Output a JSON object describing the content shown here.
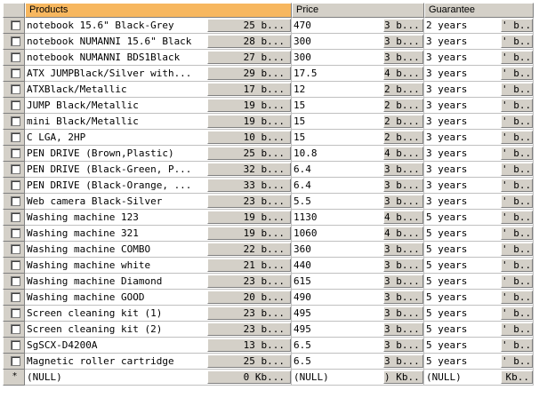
{
  "columns": {
    "products": "Products",
    "price": "Price",
    "guarantee": "Guarantee"
  },
  "rows": [
    {
      "product": "notebook 15.6\" Black-Grey",
      "pbtn": "25 b...",
      "price": "470",
      "prbtn": "3 b...",
      "guarantee": "2 years",
      "gbtn": "' b.."
    },
    {
      "product": "notebook NUMANNI 15.6\" Black",
      "pbtn": "28 b...",
      "price": "300",
      "prbtn": "3 b...",
      "guarantee": "3 years",
      "gbtn": "' b.."
    },
    {
      "product": "notebook NUMANNI BDS1Black",
      "pbtn": "27 b...",
      "price": "300",
      "prbtn": "3 b...",
      "guarantee": "3 years",
      "gbtn": "' b.."
    },
    {
      "product": "ATX JUMPBlack/Silver with...",
      "pbtn": "29 b...",
      "price": "17.5",
      "prbtn": "4 b...",
      "guarantee": "3 years",
      "gbtn": "' b.."
    },
    {
      "product": "ATXBlack/Metallic",
      "pbtn": "17 b...",
      "price": "12",
      "prbtn": "2 b...",
      "guarantee": "3 years",
      "gbtn": "' b.."
    },
    {
      "product": "JUMP Black/Metallic",
      "pbtn": "19 b...",
      "price": "15",
      "prbtn": "2 b...",
      "guarantee": "3 years",
      "gbtn": "' b.."
    },
    {
      "product": "mini Black/Metallic",
      "pbtn": "19 b...",
      "price": "15",
      "prbtn": "2 b...",
      "guarantee": "3 years",
      "gbtn": "' b.."
    },
    {
      "product": "C LGA, 2HP",
      "pbtn": "10 b...",
      "price": "15",
      "prbtn": "2 b...",
      "guarantee": "3 years",
      "gbtn": "' b.."
    },
    {
      "product": "PEN DRIVE (Brown,Plastic)",
      "pbtn": "25 b...",
      "price": "10.8",
      "prbtn": "4 b...",
      "guarantee": "3 years",
      "gbtn": "' b.."
    },
    {
      "product": "PEN DRIVE (Black-Green, P...",
      "pbtn": "32 b...",
      "price": "6.4",
      "prbtn": "3 b...",
      "guarantee": "3 years",
      "gbtn": "' b.."
    },
    {
      "product": "PEN DRIVE (Black-Orange, ...",
      "pbtn": "33 b...",
      "price": "6.4",
      "prbtn": "3 b...",
      "guarantee": "3 years",
      "gbtn": "' b.."
    },
    {
      "product": "Web camera Black-Silver",
      "pbtn": "23 b...",
      "price": "5.5",
      "prbtn": "3 b...",
      "guarantee": "3 years",
      "gbtn": "' b.."
    },
    {
      "product": "Washing machine 123",
      "pbtn": "19 b...",
      "price": "1130",
      "prbtn": "4 b...",
      "guarantee": "5 years",
      "gbtn": "' b.."
    },
    {
      "product": "Washing machine 321",
      "pbtn": "19 b...",
      "price": "1060",
      "prbtn": "4 b...",
      "guarantee": "5 years",
      "gbtn": "' b.."
    },
    {
      "product": "Washing machine COMBO",
      "pbtn": "22 b...",
      "price": "360",
      "prbtn": "3 b...",
      "guarantee": "5 years",
      "gbtn": "' b.."
    },
    {
      "product": "Washing machine white",
      "pbtn": "21 b...",
      "price": "440",
      "prbtn": "3 b...",
      "guarantee": "5 years",
      "gbtn": "' b.."
    },
    {
      "product": "Washing machine Diamond",
      "pbtn": "23 b...",
      "price": "615",
      "prbtn": "3 b...",
      "guarantee": "5 years",
      "gbtn": "' b.."
    },
    {
      "product": "Washing machine GOOD",
      "pbtn": "20 b...",
      "price": "490",
      "prbtn": "3 b...",
      "guarantee": "5 years",
      "gbtn": "' b.."
    },
    {
      "product": "Screen cleaning kit (1)",
      "pbtn": "23 b...",
      "price": "495",
      "prbtn": "3 b...",
      "guarantee": "5 years",
      "gbtn": "' b.."
    },
    {
      "product": "Screen cleaning kit (2)",
      "pbtn": "23 b...",
      "price": "495",
      "prbtn": "3 b...",
      "guarantee": "5 years",
      "gbtn": "' b.."
    },
    {
      "product": "SgSCX-D4200A",
      "pbtn": "13 b...",
      "price": "6.5",
      "prbtn": "3 b...",
      "guarantee": "5 years",
      "gbtn": "' b.."
    },
    {
      "product": "Magnetic roller cartridge",
      "pbtn": "25 b...",
      "price": "6.5",
      "prbtn": "3 b...",
      "guarantee": "5 years",
      "gbtn": "' b.."
    }
  ],
  "new_row": {
    "marker": "*",
    "product": "(NULL)",
    "pbtn": "0 Kb...",
    "price": "(NULL)",
    "prbtn": ") Kb..",
    "guarantee": "(NULL)",
    "gbtn": "Kb.."
  },
  "colors": {
    "header_active": "#f7b75f",
    "header": "#d4d0c8",
    "gridline": "#c0c0c0"
  }
}
